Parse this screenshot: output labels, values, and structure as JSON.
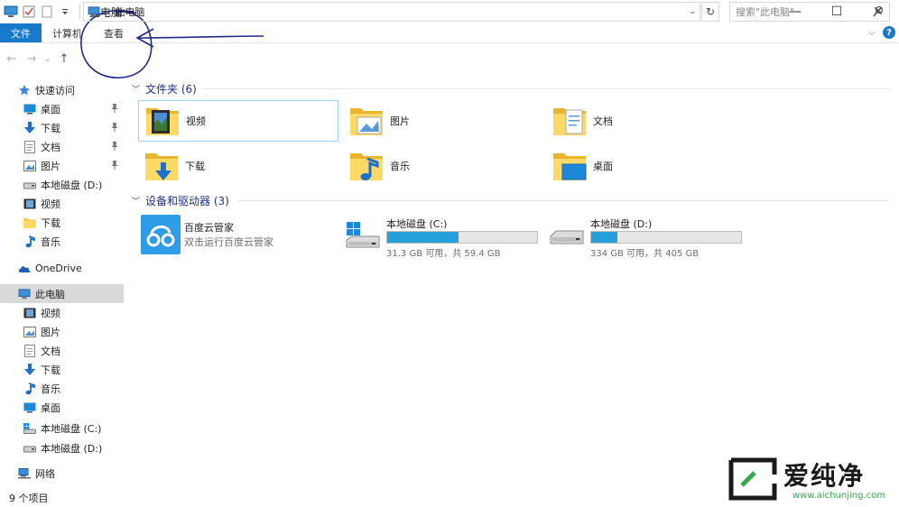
{
  "window": {
    "title": "此电脑",
    "controls": {
      "minimize": "—",
      "maximize": "☐",
      "close": "✕"
    }
  },
  "ribbon": {
    "tabs": [
      "文件",
      "计算机",
      "查看"
    ],
    "help_label": "?",
    "collapse_label": "⌵"
  },
  "address": {
    "back": "←",
    "forward": "→",
    "recent": "⌄",
    "up": "↑",
    "separator": "›",
    "crumb": "此电脑",
    "search_placeholder": "搜索\"此电脑\""
  },
  "nav": {
    "items": [
      {
        "label": "快速访问",
        "icon": "star-icon"
      },
      {
        "label": "桌面",
        "icon": "desktop-icon",
        "pinned": true
      },
      {
        "label": "下载",
        "icon": "download-icon",
        "pinned": true
      },
      {
        "label": "文档",
        "icon": "document-icon",
        "pinned": true
      },
      {
        "label": "图片",
        "icon": "picture-icon",
        "pinned": true
      },
      {
        "label": "本地磁盘 (D:)",
        "icon": "drive-icon"
      },
      {
        "label": "视频",
        "icon": "video-icon"
      },
      {
        "label": "下载",
        "icon": "folder-icon"
      },
      {
        "label": "音乐",
        "icon": "music-icon"
      },
      {
        "label": "OneDrive",
        "icon": "cloud-icon"
      },
      {
        "label": "此电脑",
        "icon": "computer-icon",
        "selected": true
      },
      {
        "label": "视频",
        "icon": "video-icon"
      },
      {
        "label": "图片",
        "icon": "picture-icon"
      },
      {
        "label": "文档",
        "icon": "document-icon"
      },
      {
        "label": "下载",
        "icon": "download-icon"
      },
      {
        "label": "音乐",
        "icon": "music-icon"
      },
      {
        "label": "桌面",
        "icon": "desktop-icon"
      },
      {
        "label": "本地磁盘 (C:)",
        "icon": "windows-drive-icon"
      },
      {
        "label": "本地磁盘 (D:)",
        "icon": "drive-icon"
      },
      {
        "label": "网络",
        "icon": "network-icon"
      }
    ]
  },
  "folders": {
    "heading": "文件夹 (6)",
    "items": [
      {
        "label": "视频",
        "icon": "video-folder-icon"
      },
      {
        "label": "图片",
        "icon": "picture-folder-icon"
      },
      {
        "label": "文档",
        "icon": "document-folder-icon"
      },
      {
        "label": "下载",
        "icon": "download-folder-icon"
      },
      {
        "label": "音乐",
        "icon": "music-folder-icon"
      },
      {
        "label": "桌面",
        "icon": "desktop-folder-icon"
      }
    ]
  },
  "devices": {
    "heading": "设备和驱动器 (3)",
    "app": {
      "name": "百度云管家",
      "subtitle": "双击运行百度云管家"
    },
    "drives": [
      {
        "name": "本地磁盘 (C:)",
        "info": "31.3 GB 可用，共 59.4 GB",
        "used_fraction": 0.473
      },
      {
        "name": "本地磁盘 (D:)",
        "info": "334 GB 可用，共 405 GB",
        "used_fraction": 0.175
      }
    ]
  },
  "status": {
    "items_count": "9 个项目"
  },
  "watermark": {
    "text": "爱纯净",
    "url": "www.aichunjing.com"
  },
  "colors": {
    "accent": "#1979ca",
    "drive_bar": "#26a0da",
    "group_heading": "#1e3287",
    "selection": "#d9d9d9"
  }
}
